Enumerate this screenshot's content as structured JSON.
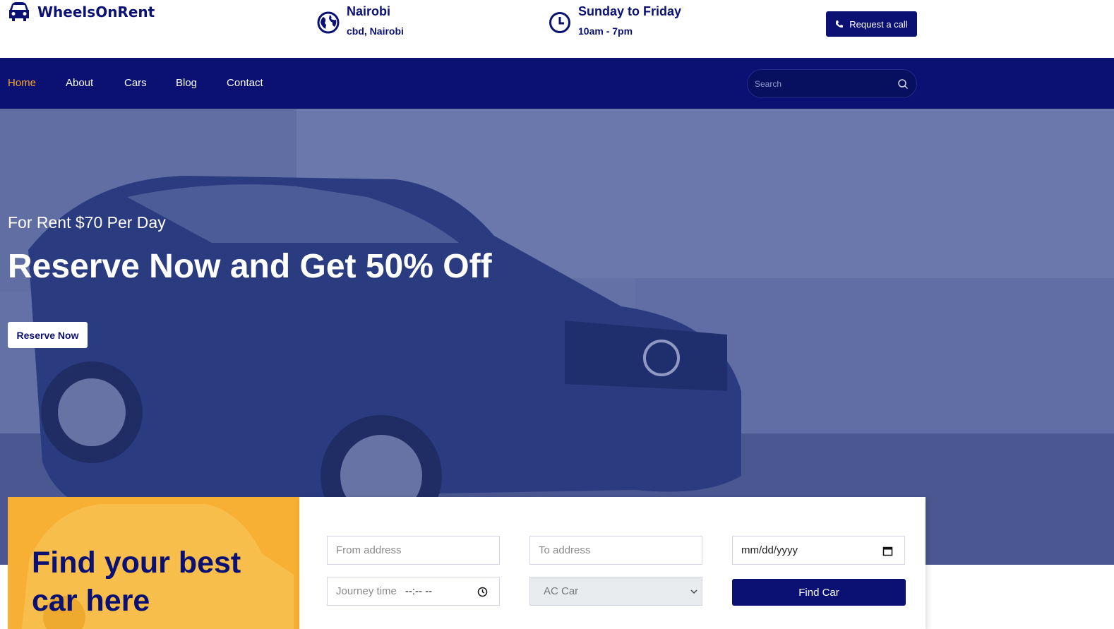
{
  "brand": {
    "name": "WheelsOnRent"
  },
  "header": {
    "location_title": "Nairobi",
    "location_sub": "cbd, Nairobi",
    "hours_title": "Sunday to Friday",
    "hours_sub": "10am - 7pm",
    "call_label": "Request a call"
  },
  "nav": {
    "items": [
      "Home",
      "About",
      "Cars",
      "Blog",
      "Contact"
    ],
    "active": "Home",
    "search_placeholder": "Search"
  },
  "hero": {
    "subtitle": "For Rent $70 Per Day",
    "title": "Reserve Now and Get 50% Off",
    "button": "Reserve Now"
  },
  "finder": {
    "heading": "Find your best car here",
    "from_placeholder": "From address",
    "to_placeholder": "To address",
    "date_value": "mm/dd/yyyy",
    "time_label": "Journey time",
    "time_value": "--:-- --",
    "car_type": "AC Car",
    "button": "Find Car"
  },
  "colors": {
    "brand_navy": "#0a1172",
    "accent_orange": "#f7a823",
    "panel_yellow": "#f7b033"
  }
}
